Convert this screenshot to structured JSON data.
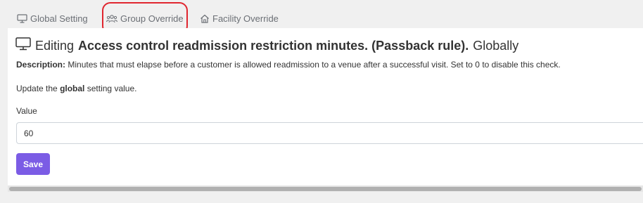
{
  "tabs": [
    {
      "label": "Global Setting",
      "icon": "monitor-icon"
    },
    {
      "label": "Group Override",
      "icon": "users-icon"
    },
    {
      "label": "Facility Override",
      "icon": "home-icon"
    }
  ],
  "highlight_color": "#e0262f",
  "heading": {
    "prefix": "Editing",
    "setting_name": "Access control readmission restriction minutes. (Passback rule).",
    "scope": "Globally"
  },
  "description": {
    "label": "Description:",
    "text": "Minutes that must elapse before a customer is allowed readmission to a venue after a successful visit. Set to 0 to disable this check."
  },
  "update_note": {
    "before": "Update the",
    "bold": "global",
    "after": "setting value."
  },
  "field": {
    "label": "Value",
    "value": "60"
  },
  "save_label": "Save",
  "accent_color": "#7b5ce5"
}
